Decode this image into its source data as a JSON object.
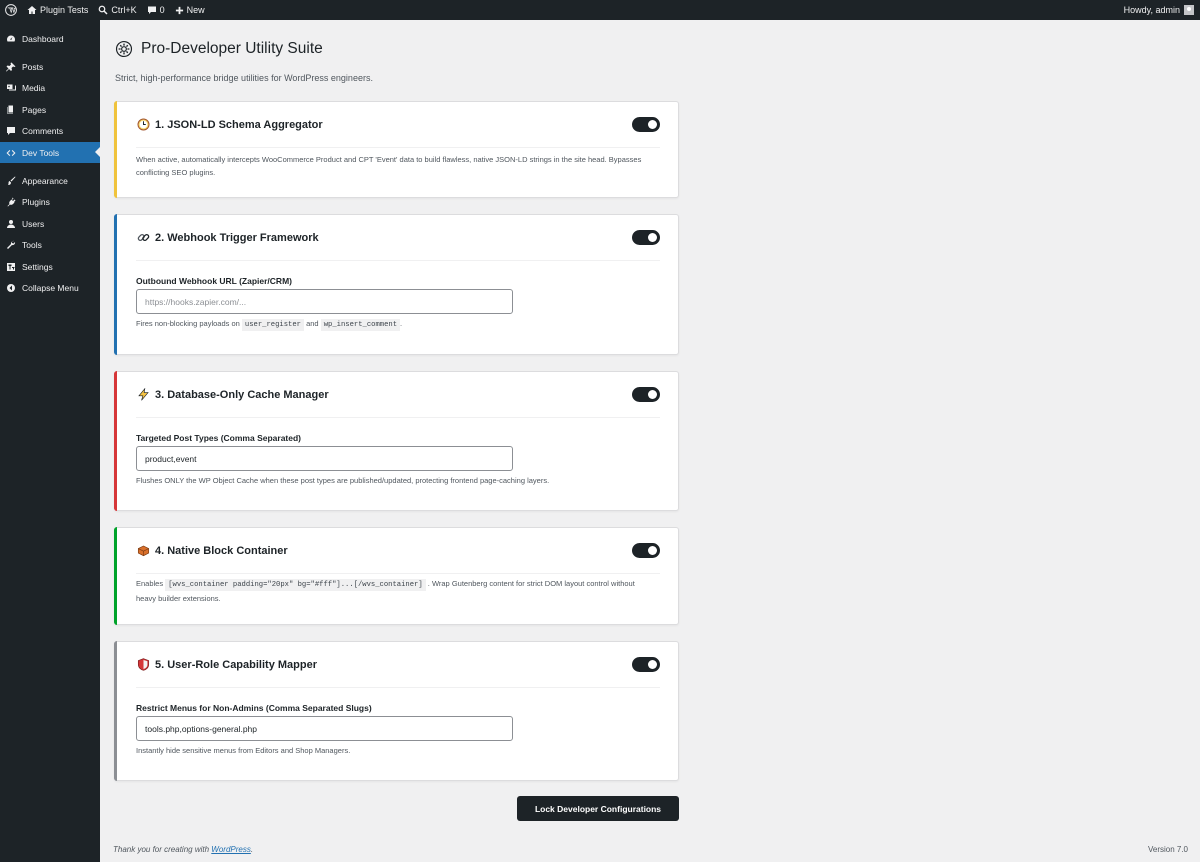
{
  "adminbar": {
    "site_name": "Plugin Tests",
    "search_shortcut": "Ctrl+K",
    "comments_count": "0",
    "new_label": "New",
    "howdy": "Howdy, admin"
  },
  "sidebar": {
    "items": [
      {
        "label": "Dashboard",
        "icon": "dashboard-icon"
      },
      {
        "label": "Posts",
        "icon": "pin-icon"
      },
      {
        "label": "Media",
        "icon": "media-icon"
      },
      {
        "label": "Pages",
        "icon": "pages-icon"
      },
      {
        "label": "Comments",
        "icon": "comment-icon"
      },
      {
        "label": "Dev Tools",
        "icon": "code-icon",
        "current": true
      },
      {
        "label": "Appearance",
        "icon": "brush-icon"
      },
      {
        "label": "Plugins",
        "icon": "plugin-icon"
      },
      {
        "label": "Users",
        "icon": "user-icon"
      },
      {
        "label": "Tools",
        "icon": "wrench-icon"
      },
      {
        "label": "Settings",
        "icon": "settings-icon"
      },
      {
        "label": "Collapse Menu",
        "icon": "collapse-icon"
      }
    ]
  },
  "page": {
    "title": "Pro-Developer Utility Suite",
    "description": "Strict, high-performance bridge utilities for WordPress engineers."
  },
  "modules": {
    "schema": {
      "title": "1. JSON-LD Schema Aggregator",
      "accent": "#f0c33c",
      "enabled": true,
      "description": "When active, automatically intercepts WooCommerce Product and CPT 'Event' data to build flawless, native JSON-LD strings in the site head. Bypasses conflicting SEO plugins."
    },
    "webhook": {
      "title": "2. Webhook Trigger Framework",
      "accent": "#2271b1",
      "enabled": true,
      "field_label": "Outbound Webhook URL (Zapier/CRM)",
      "placeholder": "https://hooks.zapier.com/...",
      "value": "",
      "hint_prefix": "Fires non-blocking payloads on",
      "code1": "user_register",
      "hint_and": "and",
      "code2": "wp_insert_comment",
      "hint_suffix": "."
    },
    "cache": {
      "title": "3. Database-Only Cache Manager",
      "accent": "#d63638",
      "enabled": true,
      "field_label": "Targeted Post Types (Comma Separated)",
      "value": "product,event",
      "hint": "Flushes ONLY the WP Object Cache when these post types are published/updated, protecting frontend page-caching layers."
    },
    "container": {
      "title": "4. Native Block Container",
      "accent": "#00a32a",
      "enabled": true,
      "hint_prefix": "Enables",
      "code": "[wvs_container padding=\"20px\" bg=\"#fff\"]...[/wvs_container]",
      "hint_line1": ". Wrap Gutenberg content for strict DOM layout control without",
      "hint_line2": "heavy builder extensions."
    },
    "roles": {
      "title": "5. User-Role Capability Mapper",
      "accent": "#8c8f94",
      "enabled": true,
      "field_label": "Restrict Menus for Non-Admins (Comma Separated Slugs)",
      "value": "tools.php,options-general.php",
      "hint": "Instantly hide sensitive menus from Editors and Shop Managers."
    }
  },
  "submit_label": "Lock Developer Configurations",
  "footer": {
    "thanks_prefix": "Thank you for creating with",
    "wordpress_link": "WordPress",
    "thanks_suffix": ".",
    "version": "Version 7.0"
  }
}
